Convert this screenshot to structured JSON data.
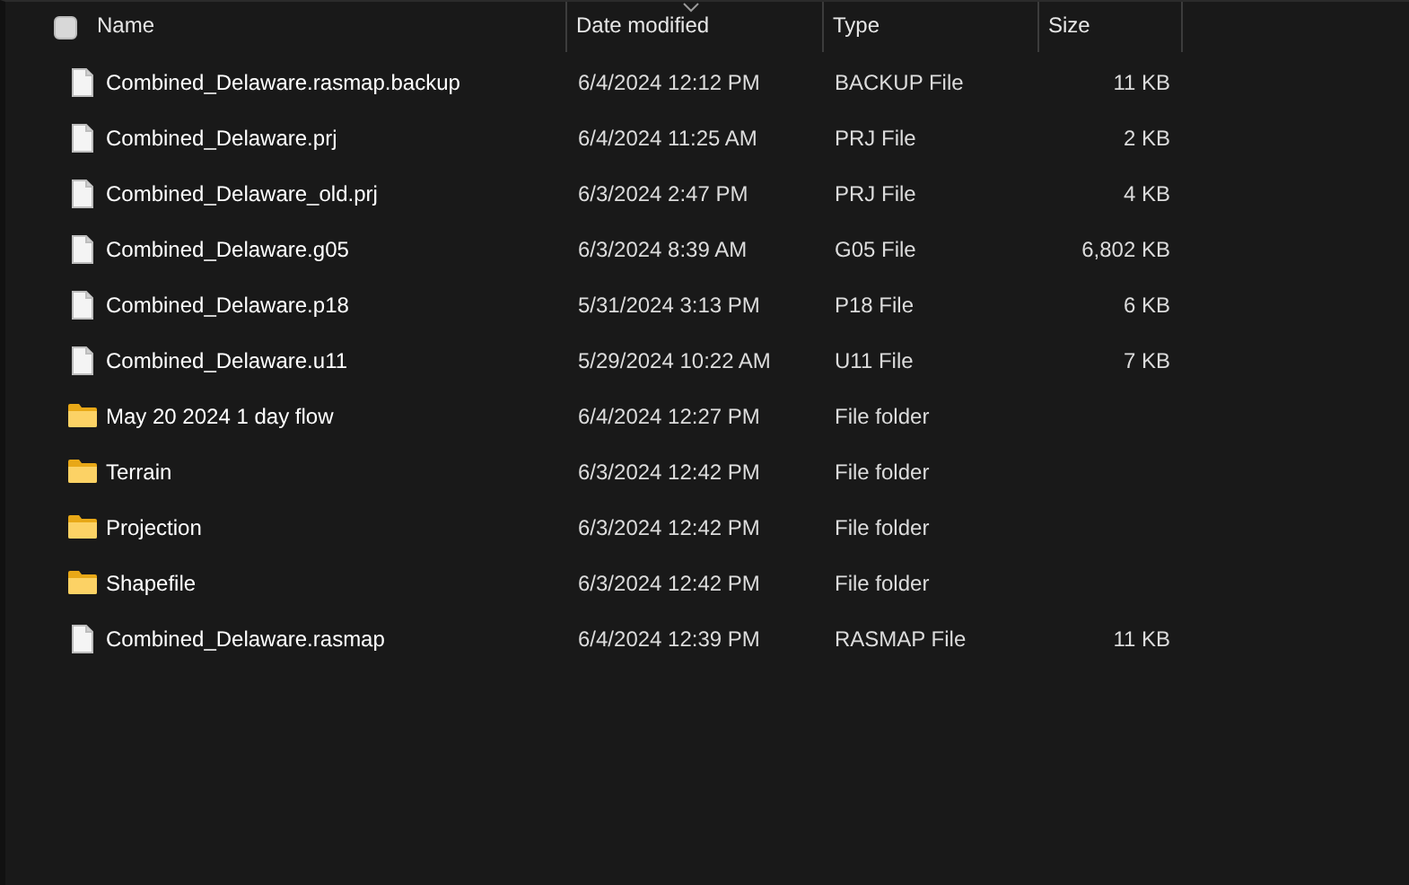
{
  "header": {
    "select_all_checked": false,
    "columns": [
      {
        "label": "Name",
        "sorted": false
      },
      {
        "label": "Date modified",
        "sorted": true
      },
      {
        "label": "Type",
        "sorted": false
      },
      {
        "label": "Size",
        "sorted": false
      }
    ]
  },
  "rows": [
    {
      "kind": "file",
      "name": "Combined_Delaware.rasmap.backup",
      "date": "6/4/2024 12:12 PM",
      "type": "BACKUP File",
      "size": "11 KB"
    },
    {
      "kind": "file",
      "name": "Combined_Delaware.prj",
      "date": "6/4/2024 11:25 AM",
      "type": "PRJ File",
      "size": "2 KB"
    },
    {
      "kind": "file",
      "name": "Combined_Delaware_old.prj",
      "date": "6/3/2024 2:47 PM",
      "type": "PRJ File",
      "size": "4 KB"
    },
    {
      "kind": "file",
      "name": "Combined_Delaware.g05",
      "date": "6/3/2024 8:39 AM",
      "type": "G05 File",
      "size": "6,802 KB"
    },
    {
      "kind": "file",
      "name": "Combined_Delaware.p18",
      "date": "5/31/2024 3:13 PM",
      "type": "P18 File",
      "size": "6 KB"
    },
    {
      "kind": "file",
      "name": "Combined_Delaware.u11",
      "date": "5/29/2024 10:22 AM",
      "type": "U11 File",
      "size": "7 KB"
    },
    {
      "kind": "folder",
      "name": "May 20 2024 1 day flow",
      "date": "6/4/2024 12:27 PM",
      "type": "File folder"
    },
    {
      "kind": "folder",
      "name": "Terrain",
      "date": "6/3/2024 12:42 PM",
      "type": "File folder"
    },
    {
      "kind": "folder",
      "name": "Projection",
      "date": "6/3/2024 12:42 PM",
      "type": "File folder"
    },
    {
      "kind": "folder",
      "name": "Shapefile",
      "date": "6/3/2024 12:42 PM",
      "type": "File folder"
    },
    {
      "kind": "file",
      "name": "Combined_Delaware.rasmap",
      "date": "6/4/2024 12:39 PM",
      "type": "RASMAP File",
      "size": "11 KB"
    }
  ]
}
